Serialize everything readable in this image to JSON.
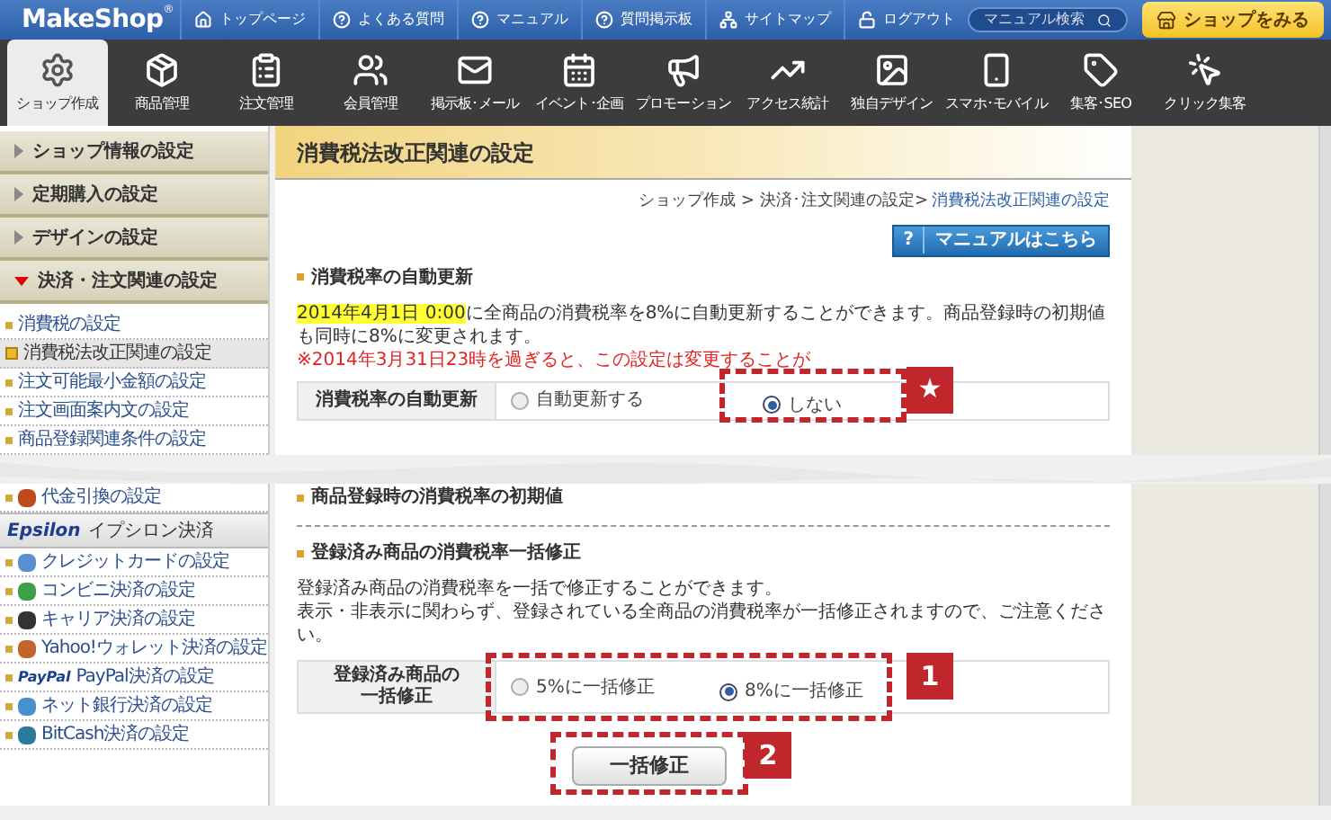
{
  "header": {
    "logo": "MakeShop",
    "logo_mark": "®",
    "links": [
      {
        "kind": "home",
        "label": "トップページ"
      },
      {
        "kind": "help",
        "label": "よくある質問"
      },
      {
        "kind": "help",
        "label": "マニュアル"
      },
      {
        "kind": "help",
        "label": "質問掲示板"
      },
      {
        "kind": "sitemap",
        "label": "サイトマップ"
      },
      {
        "kind": "logout",
        "label": "ログアウト"
      }
    ],
    "search": {
      "placeholder": "マニュアル検索"
    },
    "shop_button": "ショップをみる"
  },
  "nav": [
    {
      "label": "ショップ作成",
      "selected": true
    },
    {
      "label": "商品管理",
      "selected": false
    },
    {
      "label": "注文管理",
      "selected": false
    },
    {
      "label": "会員管理",
      "selected": false
    },
    {
      "label": "掲示板･メール",
      "selected": false
    },
    {
      "label": "イベント･企画",
      "selected": false
    },
    {
      "label": "プロモーション",
      "selected": false
    },
    {
      "label": "アクセス統計",
      "selected": false
    },
    {
      "label": "独自デザイン",
      "selected": false
    },
    {
      "label": "スマホ･モバイル",
      "selected": false
    },
    {
      "label": "集客･SEO",
      "selected": false
    },
    {
      "label": "クリック集客",
      "selected": false
    }
  ],
  "sidebar": {
    "sections": [
      {
        "label": "ショップ情報の設定",
        "expanded": false
      },
      {
        "label": "定期購入の設定",
        "expanded": false
      },
      {
        "label": "デザインの設定",
        "expanded": false
      },
      {
        "label": "決済・注文関連の設定",
        "expanded": true
      }
    ],
    "items": [
      {
        "label": "消費税の設定",
        "selected": false
      },
      {
        "label": "消費税法改正関連の設定",
        "selected": true
      },
      {
        "label": "注文可能最小金額の設定",
        "selected": false
      },
      {
        "label": "注文画面案内文の設定",
        "selected": false
      },
      {
        "label": "商品登録関連条件の設定",
        "selected": false
      }
    ],
    "items_after_cut": [
      {
        "label": "代金引換の設定"
      }
    ],
    "epsilon": {
      "logo": "Epsilon",
      "label": "イプシロン決済"
    },
    "payment_items": [
      {
        "label": "クレジットカードの設定"
      },
      {
        "label": "コンビニ決済の設定"
      },
      {
        "label": "キャリア決済の設定"
      },
      {
        "label": "Yahoo!ウォレット決済の設定"
      },
      {
        "logo": "PayPal",
        "label": "PayPal決済の設定"
      },
      {
        "label": "ネット銀行決済の設定"
      },
      {
        "label": "BitCash決済の設定"
      }
    ]
  },
  "page": {
    "title": "消費税法改正関連の設定",
    "breadcrumb": "ショップ作成 > 決済･注文関連の設定>",
    "breadcrumb_current": "消費税法改正関連の設定",
    "manual_button": {
      "icon": "?",
      "label": "マニュアルはこちら"
    },
    "auto_update": {
      "heading": "消費税率の自動更新",
      "date": "2014年4月1日 0:00",
      "text": "に全商品の消費税率を8%に自動更新することができます。商品登録時の初期値も同時に8%に変更されます。",
      "note": "※2014年3月31日23時を過ぎると、この設定は変更することが",
      "row": {
        "label": "消費税率の自動更新",
        "options": [
          {
            "label": "自動更新する",
            "selected": false
          },
          {
            "label": "しない",
            "selected": true
          }
        ]
      },
      "annotation": "★"
    },
    "initial": {
      "heading": "商品登録時の消費税率の初期値"
    },
    "bulk": {
      "heading": "登録済み商品の消費税率一括修正",
      "lines": [
        "登録済み商品の消費税率を一括で修正することができます。",
        "表示・非表示に関わらず、登録されている全商品の消費税率が一括修正されますので、ご注意ください。"
      ],
      "row": {
        "label": "登録済み商品の一括修正",
        "options": [
          {
            "label": "5%に一括修正",
            "selected": false
          },
          {
            "label": "8%に一括修正",
            "selected": true
          }
        ]
      },
      "annotation": "1",
      "button": "一括修正",
      "button_annotation": "2"
    }
  }
}
